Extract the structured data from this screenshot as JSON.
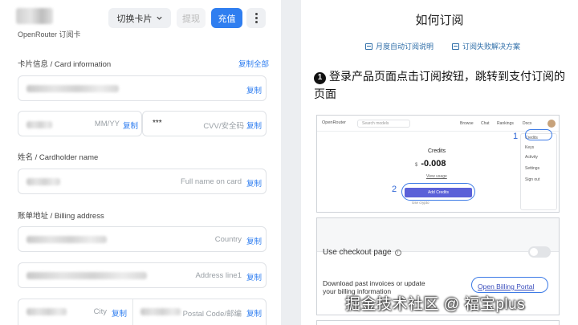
{
  "left": {
    "brand_subtitle": "OpenRouter 订阅卡",
    "buttons": {
      "switch_card": "切换卡片",
      "withdraw": "提现",
      "recharge": "充值"
    },
    "card_info": {
      "label": "卡片信息 / Card information",
      "copy_all": "复制全部",
      "expiry_placeholder": "MM/YY",
      "cvv_value": "***",
      "cvv_placeholder": "CVV/安全码"
    },
    "cardholder": {
      "label": "姓名 / Cardholder name",
      "placeholder": "Full name on card"
    },
    "billing": {
      "label": "账单地址 / Billing address",
      "country_placeholder": "Country",
      "address_placeholder": "Address line1",
      "city_placeholder": "City",
      "postal_placeholder": "Postal Code/邮编"
    },
    "copy_label": "复制"
  },
  "right": {
    "title": "如何订阅",
    "links": [
      "月度自动订阅说明",
      "订阅失败解决方案"
    ],
    "step1": {
      "number": "1",
      "text": "登录产品页面点击订阅按钮，跳转到支付订阅的页面"
    },
    "screenshot1": {
      "logo": "OpenRouter",
      "search_placeholder": "Search models",
      "nav": [
        "Browse",
        "Chat",
        "Rankings",
        "Docs"
      ],
      "menu": [
        "Credits",
        "Keys",
        "Activity",
        "Settings",
        "Sign out"
      ],
      "credits_title": "Credits",
      "currency": "$",
      "amount": "-0.008",
      "view_usage": "View usage",
      "add_credits": "Add Credits",
      "small_note": "Use crypto",
      "marker_1": "1",
      "marker_2": "2"
    },
    "screenshot2": {
      "checkout_label": "Use checkout page",
      "desc": "Download past invoices or update your billing information",
      "portal_link": "Open Billing Portal"
    }
  },
  "watermark": "掘金技术社区 @ 福宝plus"
}
